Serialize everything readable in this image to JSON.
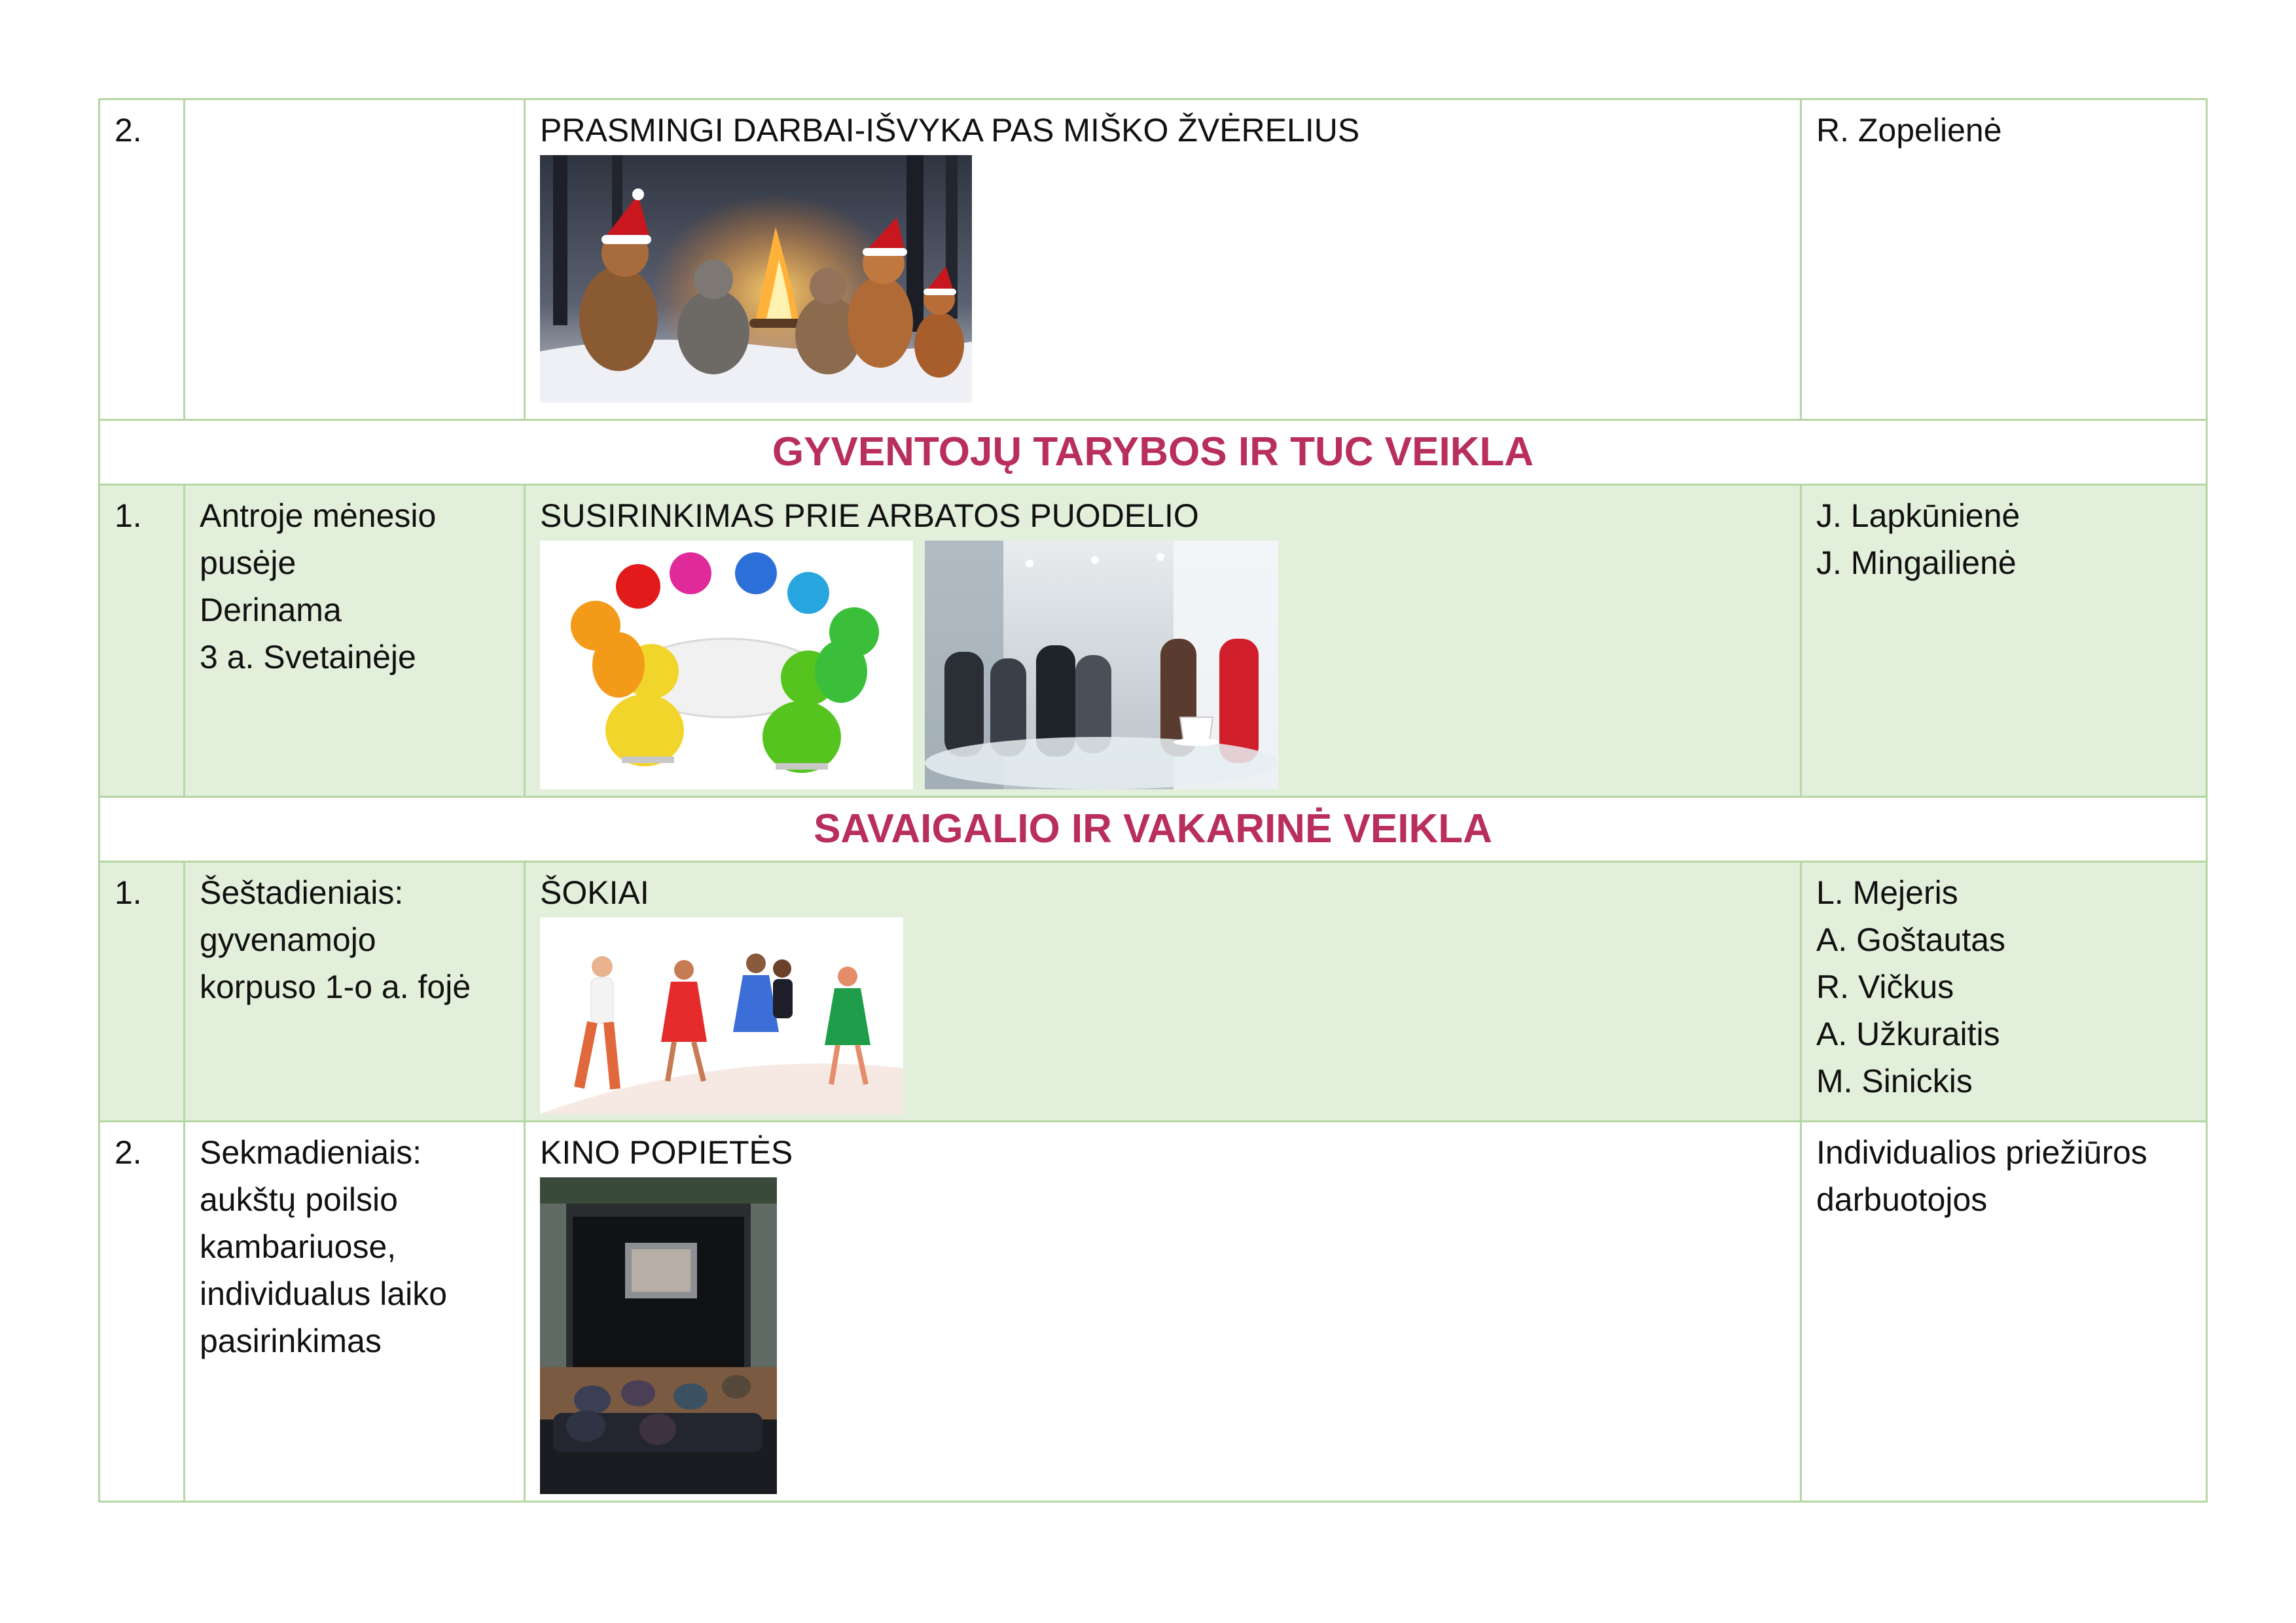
{
  "rows": [
    {
      "num": "2.",
      "when": [],
      "title": "PRASMINGI DARBAI-IŠVYKA PAS MIŠKO ŽVĖRELIUS",
      "responsible": [
        "R. Zopelienė"
      ]
    },
    {
      "num": "1.",
      "when": [
        "Antroje mėnesio",
        "pusėje",
        "Derinama",
        "3 a. Svetainėje"
      ],
      "title": "SUSIRINKIMAS PRIE ARBATOS PUODELIO",
      "responsible": [
        "J. Lapkūnienė",
        "J. Mingailienė"
      ]
    },
    {
      "num": "1.",
      "when": [
        "Šeštadieniais:",
        "gyvenamojo",
        "korpuso 1-o a. fojė"
      ],
      "title": "ŠOKIAI",
      "responsible": [
        "L. Mejeris",
        "A. Goštautas",
        "R. Vičkus",
        "A. Užkuraitis",
        "M. Sinickis"
      ]
    },
    {
      "num": "2.",
      "when": [
        "Sekmadieniais:",
        "aukštų poilsio",
        "kambariuose,",
        "individualus laiko",
        "pasirinkimas"
      ],
      "title": "KINO POPIETĖS",
      "responsible": [
        "Individualios priežiūros",
        "darbuotojos"
      ]
    }
  ],
  "sections": {
    "council": "GYVENTOJŲ TARYBOS IR TUC VEIKLA",
    "weekend": "SAVAIGALIO IR VAKARINĖ VEIKLA"
  },
  "colors": {
    "section_text": "#b82e5f",
    "row_highlight": "#e2efda",
    "border": "#b5d7a3"
  }
}
